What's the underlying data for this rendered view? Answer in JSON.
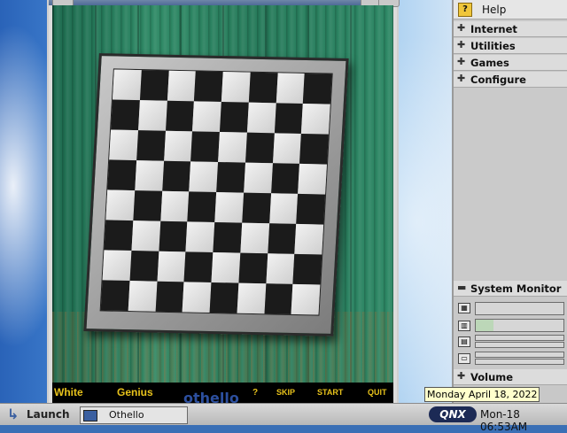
{
  "game": {
    "title": "othello",
    "menu": {
      "white": "White",
      "genius": "Genius",
      "help": "?",
      "skip": "SKIP",
      "start": "START",
      "quit": "QUIT"
    }
  },
  "panel": {
    "help": "Help",
    "items": [
      "Internet",
      "Utilities",
      "Games",
      "Configure"
    ],
    "system_monitor": "System Monitor",
    "volume": "Volume",
    "monitors": [
      {
        "icon": "cpu-icon",
        "level": 0.0
      },
      {
        "icon": "memory-icon",
        "level": 0.2
      },
      {
        "icon": "disk-icon",
        "level": 0.0
      },
      {
        "icon": "network-icon",
        "level": 0.0
      }
    ]
  },
  "tooltip": "Monday April 18, 2022",
  "taskbar": {
    "launch": "Launch",
    "task": "Othello",
    "clock": "Mon-18 06:53AM",
    "logo": "QNX"
  },
  "colors": {
    "felt": "#2f8a66",
    "menu_text": "#e7c21b",
    "title_text": "#2c4f9e"
  }
}
